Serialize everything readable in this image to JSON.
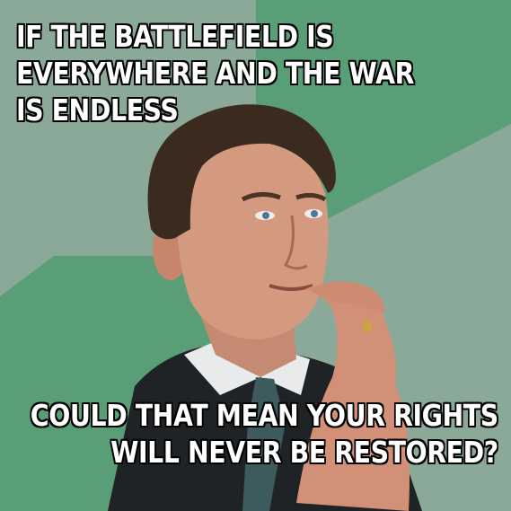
{
  "meme": {
    "top_text": [
      "IF THE BATTLEFIELD IS",
      "EVERYWHERE AND THE WAR",
      "IS ENDLESS"
    ],
    "bottom_text": [
      "COULD THAT MEAN YOUR RIGHTS",
      "WILL NEVER BE RESTORED?"
    ]
  },
  "colors": {
    "background_light": "#8aa999",
    "background_dark": "#5a9e77",
    "caption_fill": "#ffffff",
    "caption_outline": "#000000"
  },
  "image": {
    "subject": "thoughtful-man-photo"
  }
}
